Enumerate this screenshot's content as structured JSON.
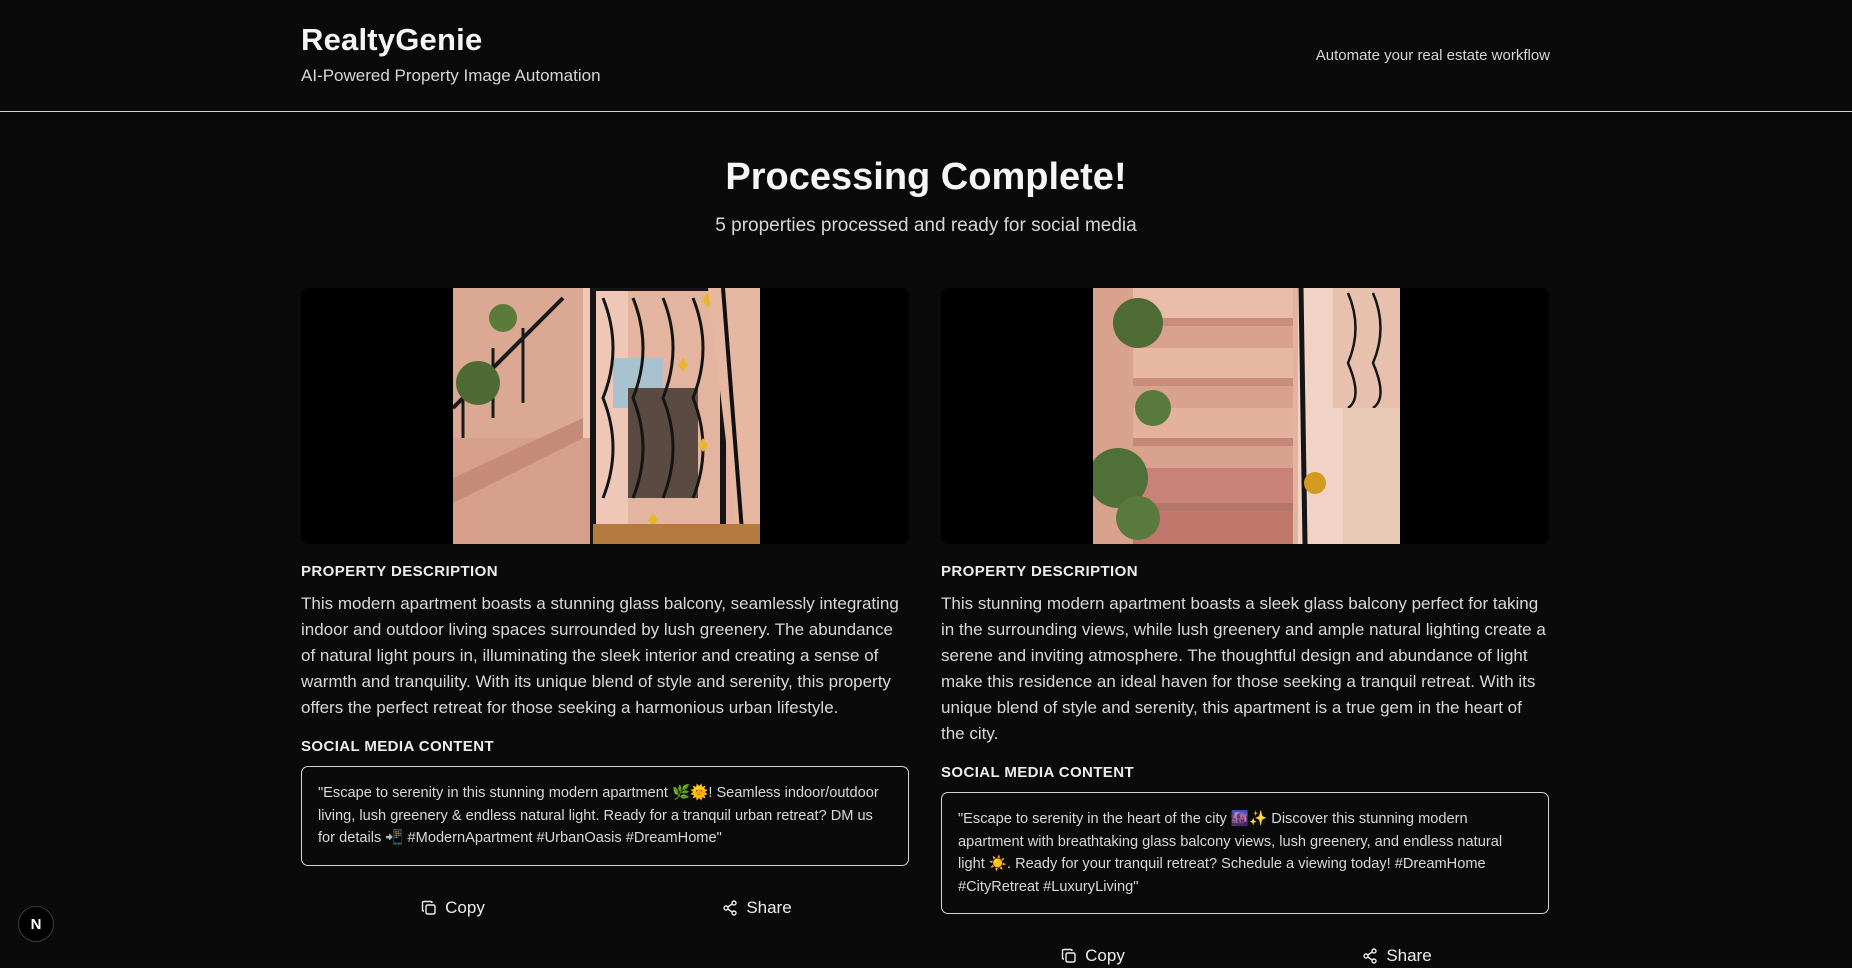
{
  "header": {
    "title": "RealtyGenie",
    "subtitle": "AI-Powered Property Image Automation",
    "tagline": "Automate your real estate workflow"
  },
  "hero": {
    "title": "Processing Complete!",
    "subtitle": "5 properties processed and ready for social media"
  },
  "cards": [
    {
      "description_label": "PROPERTY DESCRIPTION",
      "description": "This modern apartment boasts a stunning glass balcony, seamlessly integrating indoor and outdoor living spaces surrounded by lush greenery. The abundance of natural light pours in, illuminating the sleek interior and creating a sense of warmth and tranquility. With its unique blend of style and serenity, this property offers the perfect retreat for those seeking a harmonious urban lifestyle.",
      "social_label": "SOCIAL MEDIA CONTENT",
      "social": "\"Escape to serenity in this stunning modern apartment 🌿🌞! Seamless indoor/outdoor living, lush greenery & endless natural light. Ready for a tranquil urban retreat? DM us for details 📲 #ModernApartment #UrbanOasis #DreamHome\"",
      "copy_label": "Copy",
      "share_label": "Share"
    },
    {
      "description_label": "PROPERTY DESCRIPTION",
      "description": "This stunning modern apartment boasts a sleek glass balcony perfect for taking in the surrounding views, while lush greenery and ample natural lighting create a serene and inviting atmosphere. The thoughtful design and abundance of light make this residence an ideal haven for those seeking a tranquil retreat. With its unique blend of style and serenity, this apartment is a true gem in the heart of the city.",
      "social_label": "SOCIAL MEDIA CONTENT",
      "social": "\"Escape to serenity in the heart of the city 🌆✨ Discover this stunning modern apartment with breathtaking glass balcony views, lush greenery, and endless natural light ☀️. Ready for your tranquil retreat? Schedule a viewing today! #DreamHome #CityRetreat #LuxuryLiving\"",
      "copy_label": "Copy",
      "share_label": "Share"
    }
  ],
  "badge": {
    "letter": "N"
  },
  "icons": [
    "copy-icon",
    "share-icon"
  ],
  "colors": {
    "background": "#0a0a0a",
    "text": "#ededed",
    "border": "#d4d4d4"
  }
}
